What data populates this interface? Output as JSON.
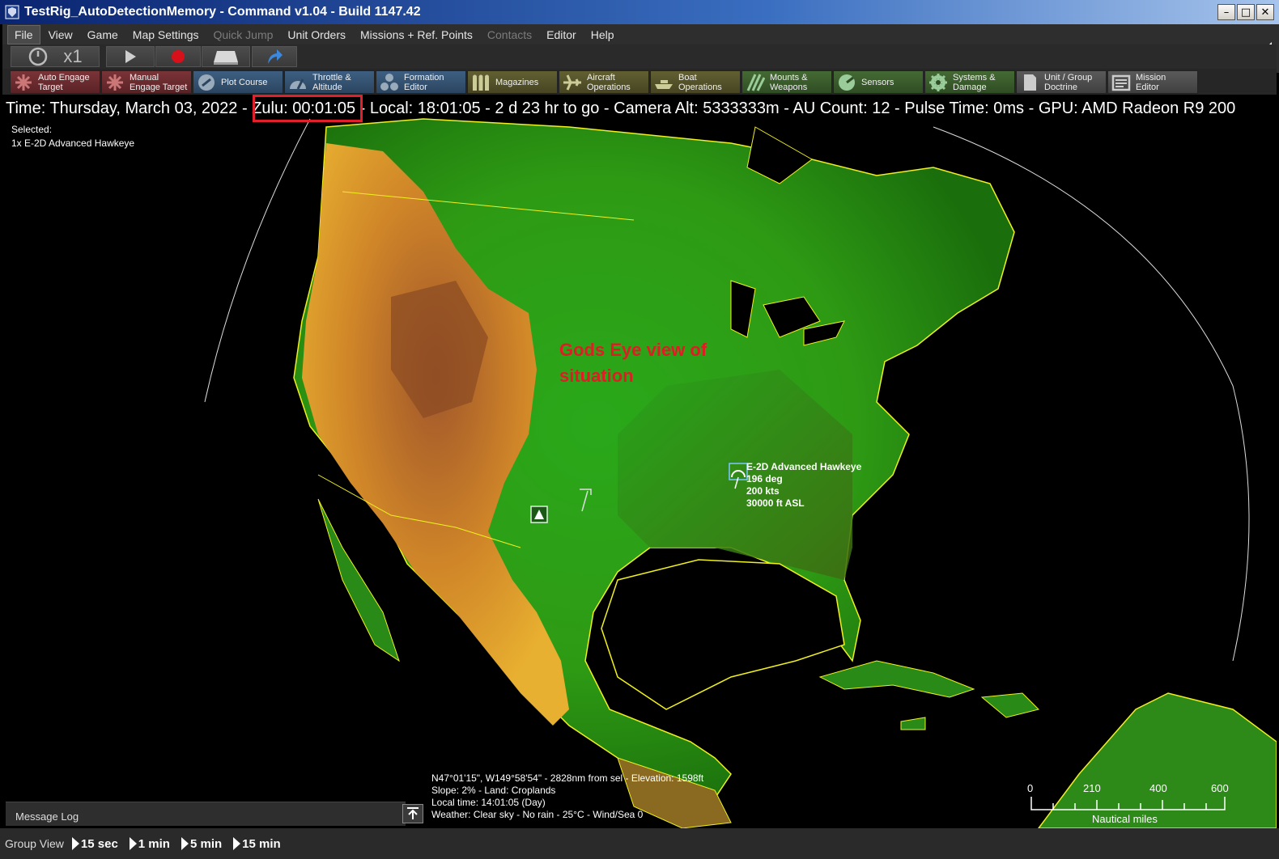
{
  "window": {
    "title": "TestRig_AutoDetectionMemory - Command v1.04 - Build 1147.42"
  },
  "menu": [
    {
      "label": "File",
      "state": "active"
    },
    {
      "label": "View",
      "state": "normal"
    },
    {
      "label": "Game",
      "state": "normal"
    },
    {
      "label": "Map Settings",
      "state": "normal"
    },
    {
      "label": "Quick Jump",
      "state": "disabled"
    },
    {
      "label": "Unit Orders",
      "state": "normal"
    },
    {
      "label": "Missions + Ref. Points",
      "state": "normal"
    },
    {
      "label": "Contacts",
      "state": "disabled"
    },
    {
      "label": "Editor",
      "state": "normal"
    },
    {
      "label": "Help",
      "state": "normal"
    }
  ],
  "playback": {
    "speed": "x1",
    "icons": [
      "clock-icon",
      "play-icon",
      "record-icon",
      "layer-icon",
      "jump-arrow-icon"
    ]
  },
  "commands": [
    {
      "line1": "Auto Engage",
      "line2": "Target",
      "color": "red",
      "icon": "crosshair-icon"
    },
    {
      "line1": "Manual",
      "line2": "Engage Target",
      "color": "red",
      "icon": "crosshair-icon"
    },
    {
      "line1": "Plot Course",
      "line2": "",
      "color": "blue",
      "icon": "course-icon"
    },
    {
      "line1": "Throttle &",
      "line2": "Altitude",
      "color": "blue",
      "icon": "throttle-icon"
    },
    {
      "line1": "Formation",
      "line2": "Editor",
      "color": "blue",
      "icon": "formation-icon"
    },
    {
      "line1": "Magazines",
      "line2": "",
      "color": "olive",
      "icon": "magazine-icon"
    },
    {
      "line1": "Aircraft",
      "line2": "Operations",
      "color": "olive",
      "icon": "aircraft-icon"
    },
    {
      "line1": "Boat",
      "line2": "Operations",
      "color": "olive",
      "icon": "boat-icon"
    },
    {
      "line1": "Mounts &",
      "line2": "Weapons",
      "color": "green",
      "icon": "weapons-icon"
    },
    {
      "line1": "Sensors",
      "line2": "",
      "color": "green",
      "icon": "sensor-icon"
    },
    {
      "line1": "Systems &",
      "line2": "Damage",
      "color": "green",
      "icon": "gear-icon"
    },
    {
      "line1": "Unit / Group",
      "line2": "Doctrine",
      "color": "gray",
      "icon": "doctrine-icon"
    },
    {
      "line1": "Mission",
      "line2": "Editor",
      "color": "gray",
      "icon": "mission-icon"
    }
  ],
  "status": {
    "text": "Time: Thursday, March 03, 2022 - Zulu: 00:01:05 - Local: 18:01:05 - 2 d 23 hr to go -  Camera Alt: 5333333m  - AU Count: 12 - Pulse Time: 0ms - GPU: AMD Radeon R9 200"
  },
  "selected": {
    "label": "Selected:",
    "value": "1x E-2D Advanced Hawkeye"
  },
  "annotation": {
    "line1": "Gods Eye view of",
    "line2": "situation",
    "color": "#e01c24"
  },
  "unit": {
    "name": "E-2D Advanced Hawkeye",
    "heading": "196 deg",
    "speed": "200 kts",
    "altitude": "30000 ft ASL"
  },
  "hover": {
    "line1": "N47°01'15\", W149°58'54\" - 2828nm from sel - Elevation: 1598ft",
    "line2": "Slope: 2%  - Land: Croplands",
    "line3": "Local time: 14:01:05 (Day)",
    "line4": "Weather: Clear sky - No rain - 25°C - Wind/Sea 0"
  },
  "scale": {
    "ticks": [
      "0",
      "210",
      "400",
      "600"
    ],
    "unit": "Nautical miles"
  },
  "message_log": {
    "label": "Message Log"
  },
  "bottom": {
    "group_view": "Group View",
    "steps": [
      "15 sec",
      "1 min",
      "5 min",
      "15 min"
    ]
  },
  "colors": {
    "land_high": "#c86a1c",
    "land_low": "#1f8a12",
    "coastline": "#f0f020",
    "highlight": "#e0202a"
  }
}
